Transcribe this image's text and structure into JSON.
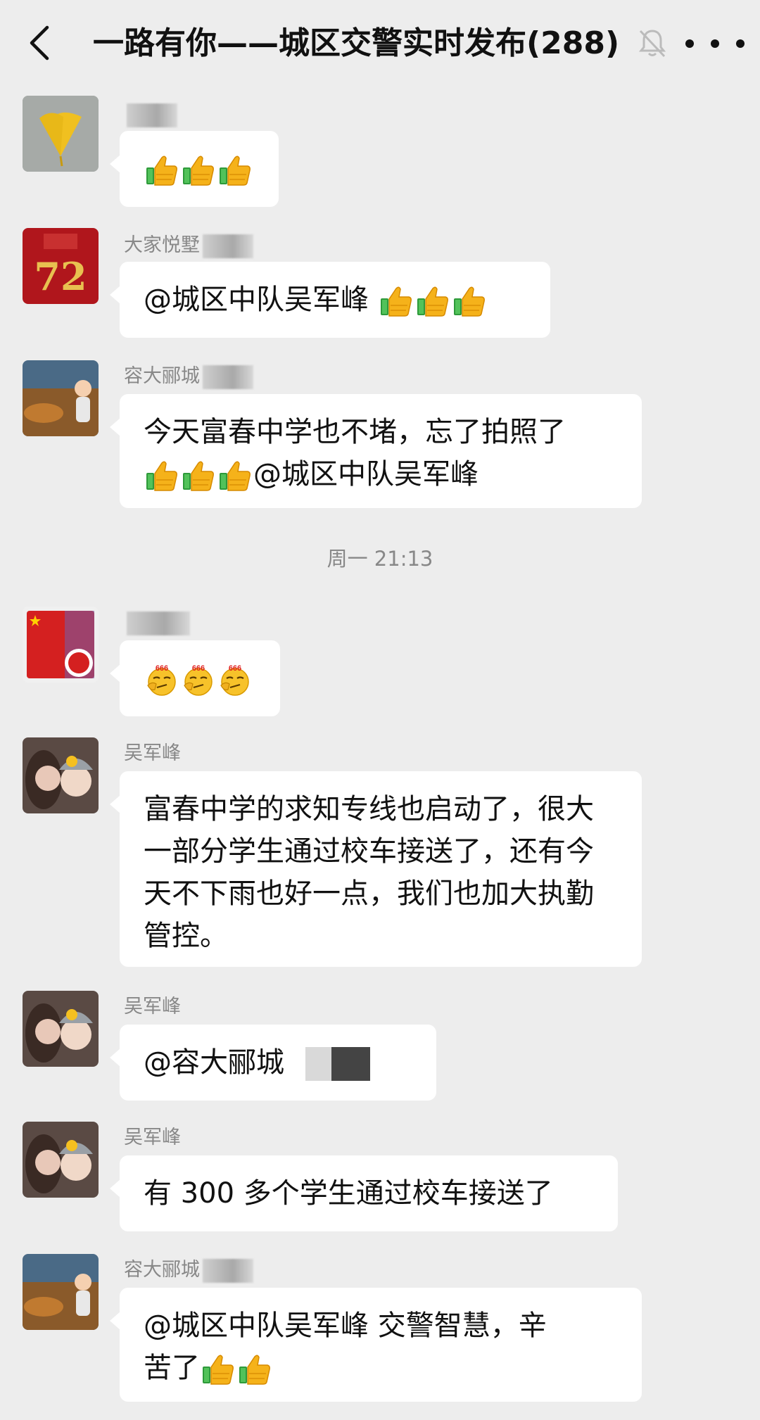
{
  "header": {
    "back_icon": "chevron-left-icon",
    "title": "一路有你——城区交警实时发布(288)",
    "mute_icon": "bell-muted-icon",
    "more_icon": "more-dots-icon"
  },
  "time_separator": "周一 21:13",
  "messages": [
    {
      "sender": "",
      "parts": []
    },
    {
      "sender": "大家悦墅",
      "text": "@城区中队吴军峰 "
    },
    {
      "sender": "容大郦城",
      "line1": "今天富春中学也不堵，忘了拍照了",
      "line2_text": "@城区中队吴军峰"
    },
    {
      "sender": ""
    },
    {
      "sender": "吴军峰",
      "text": "富春中学的求知专线也启动了，很大一部分学生通过校车接送了，还有今天不下雨也好一点，我们也加大执勤管控。"
    },
    {
      "sender": "吴军峰",
      "text": "@容大郦城"
    },
    {
      "sender": "吴军峰",
      "text": "有 300 多个学生通过校车接送了"
    },
    {
      "sender": "容大郦城",
      "line1": "@城区中队吴军峰  交警智慧，辛",
      "line2_text": "苦了"
    }
  ],
  "emojis": {
    "thumbs_up": "thumbs-up-icon",
    "smug_666": "smug-666-icon",
    "smug_label": "666"
  }
}
